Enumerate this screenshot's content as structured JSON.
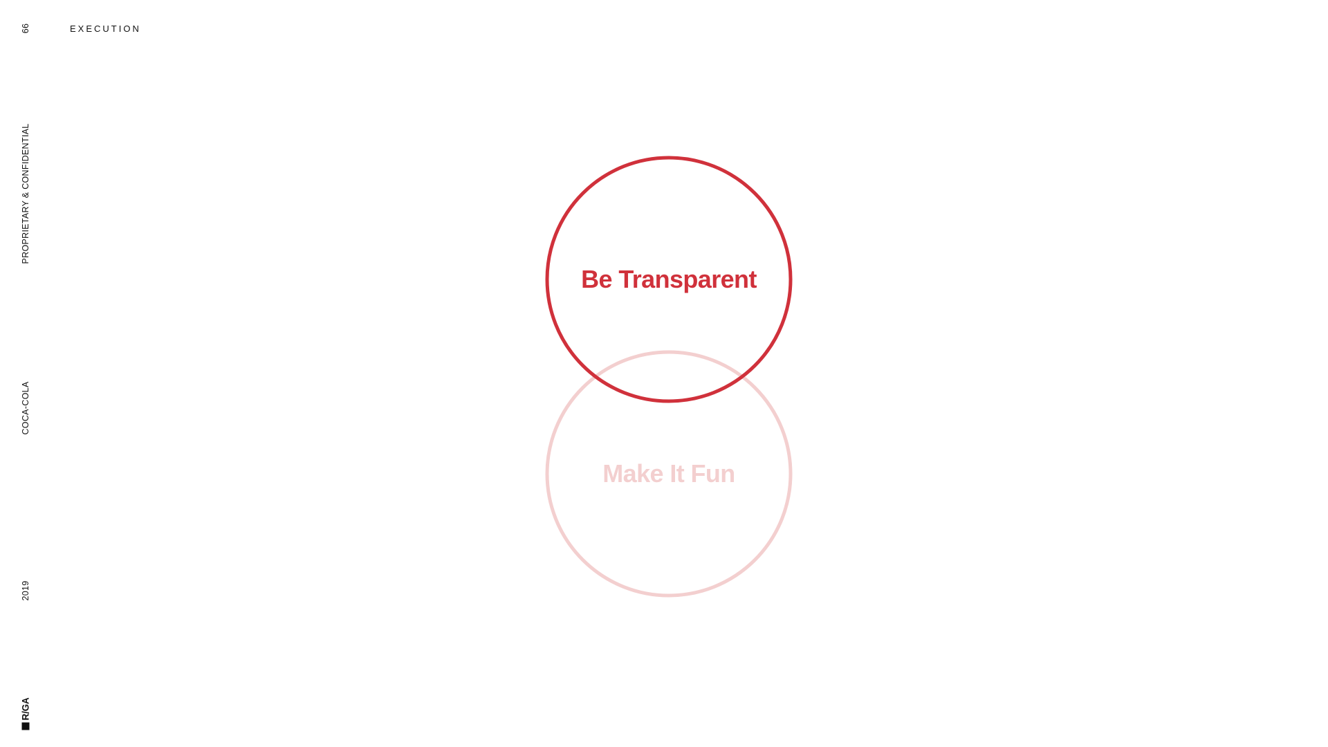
{
  "header": {
    "page_number": "66",
    "section": "EXECUTION"
  },
  "side_rail": {
    "confidential": "PROPRIETARY & CONFIDENTIAL",
    "client": "COCA-COLA",
    "year": "2019",
    "logo_text": "R/GA"
  },
  "diagram": {
    "circles": [
      {
        "label": "Be Transparent",
        "emphasis": "active",
        "color": "#d0313b"
      },
      {
        "label": "Make It Fun",
        "emphasis": "faded",
        "color": "#f3cfcf"
      }
    ]
  },
  "colors": {
    "accent": "#d0313b",
    "accent_faded": "#f3cfcf",
    "text": "#111111",
    "background": "#ffffff"
  }
}
